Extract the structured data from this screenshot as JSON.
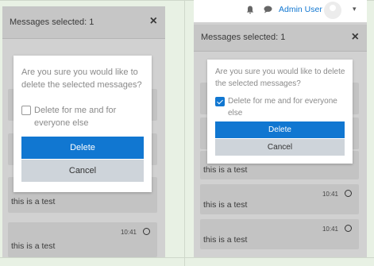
{
  "left": {
    "header_title": "Messages selected: 1",
    "close_glyph": "×",
    "messages": [
      {
        "text": "this is a test",
        "time": ""
      },
      {
        "text": "this is a test",
        "time": "10:41"
      }
    ],
    "dialog": {
      "question": "Are you sure you would like to delete the selected messages?",
      "checkbox_label": "Delete for me and for everyone else",
      "checkbox_checked": false,
      "delete_label": "Delete",
      "cancel_label": "Cancel"
    }
  },
  "right": {
    "topbar": {
      "bell_icon": "bell-icon",
      "chat_icon": "chat-icon",
      "user_name": "Admin User",
      "caret": "▾"
    },
    "header_title": "Messages selected: 1",
    "close_glyph": "×",
    "messages": [
      {
        "text": "this is a test",
        "time": ""
      },
      {
        "text": "this is a test",
        "time": "10:41"
      },
      {
        "text": "this is a test",
        "time": "10:41"
      }
    ],
    "dialog": {
      "question": "Are you sure you would like to delete the selected messages?",
      "checkbox_label": "Delete for me and for everyone else",
      "checkbox_checked": true,
      "delete_label": "Delete",
      "cancel_label": "Cancel"
    }
  },
  "colors": {
    "primary": "#1177d1",
    "overlay": "#d1d1d1",
    "secondary_btn": "#ced4da"
  }
}
